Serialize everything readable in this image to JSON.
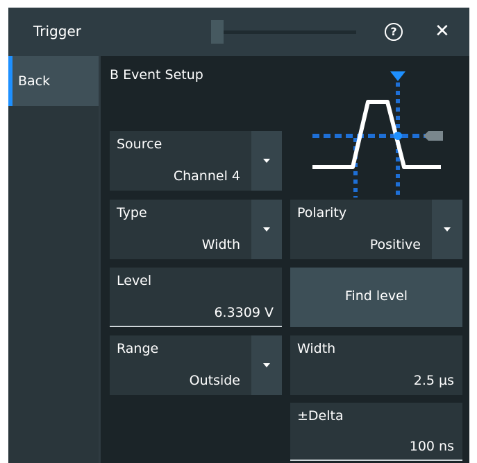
{
  "header": {
    "title": "Trigger",
    "help_icon": "?",
    "close_icon": "✕"
  },
  "sidebar": {
    "back_label": "Back"
  },
  "main": {
    "section_title": "B Event Setup",
    "source": {
      "label": "Source",
      "value": "Channel 4"
    },
    "type": {
      "label": "Type",
      "value": "Width"
    },
    "polarity": {
      "label": "Polarity",
      "value": "Positive"
    },
    "level": {
      "label": "Level",
      "value": "6.3309 V"
    },
    "find_level": {
      "label": "Find level"
    },
    "range": {
      "label": "Range",
      "value": "Outside"
    },
    "width": {
      "label": "Width",
      "value": "2.5 µs"
    },
    "delta": {
      "label": "±Delta",
      "value": "100 ns"
    }
  },
  "colors": {
    "accent": "#1e90ff",
    "panel": "#1b2428",
    "field": "#2a363b",
    "header": "#2e3c43"
  }
}
